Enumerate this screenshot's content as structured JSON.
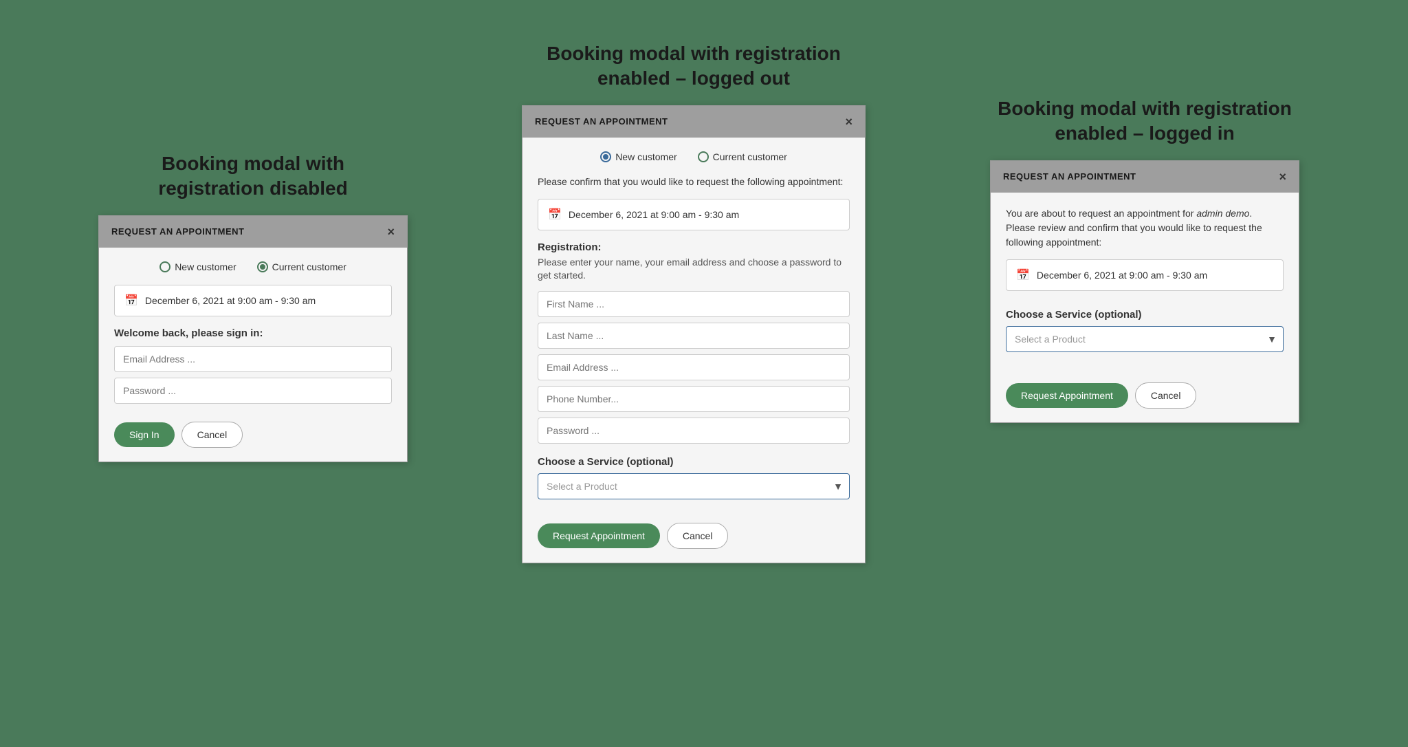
{
  "page": {
    "background": "#4a7a5a"
  },
  "col_left": {
    "title": "Booking modal with\nregistration disabled",
    "modal": {
      "header": "REQUEST AN APPOINTMENT",
      "close": "×",
      "radio_new": "New customer",
      "radio_current": "Current customer",
      "radio_new_checked": false,
      "radio_current_checked": true,
      "date_text": "December 6, 2021 at 9:00 am - 9:30 am",
      "welcome_text": "Welcome back, please sign in:",
      "email_placeholder": "Email Address ...",
      "password_placeholder": "Password ...",
      "btn_signin": "Sign In",
      "btn_cancel": "Cancel"
    }
  },
  "col_center": {
    "title": "Booking modal with registration\nenabled – logged out",
    "modal": {
      "header": "REQUEST AN APPOINTMENT",
      "close": "×",
      "radio_new": "New customer",
      "radio_current": "Current customer",
      "radio_new_checked": true,
      "radio_current_checked": false,
      "confirm_text": "Please confirm that you would like to request the following appointment:",
      "date_text": "December 6, 2021 at 9:00 am - 9:30 am",
      "registration_title": "Registration:",
      "registration_desc": "Please enter your name, your email address and choose a password to get started.",
      "first_name_placeholder": "First Name ...",
      "last_name_placeholder": "Last Name ...",
      "email_placeholder": "Email Address ...",
      "phone_placeholder": "Phone Number...",
      "password_placeholder": "Password ...",
      "service_label": "Choose a Service (optional)",
      "select_placeholder": "Select a Product",
      "btn_request": "Request Appointment",
      "btn_cancel": "Cancel"
    }
  },
  "col_right": {
    "title": "Booking modal with registration\nenabled – logged in",
    "modal": {
      "header": "REQUEST AN APPOINTMENT",
      "close": "×",
      "loggedin_desc_pre": "You are about to request an appointment for ",
      "loggedin_user": "admin demo",
      "loggedin_desc_post": ". Please review and confirm that you would like to request the following appointment:",
      "date_text": "December 6, 2021 at 9:00 am - 9:30 am",
      "service_label": "Choose a Service (optional)",
      "select_placeholder": "Select a Product",
      "btn_request": "Request Appointment",
      "btn_cancel": "Cancel"
    }
  }
}
